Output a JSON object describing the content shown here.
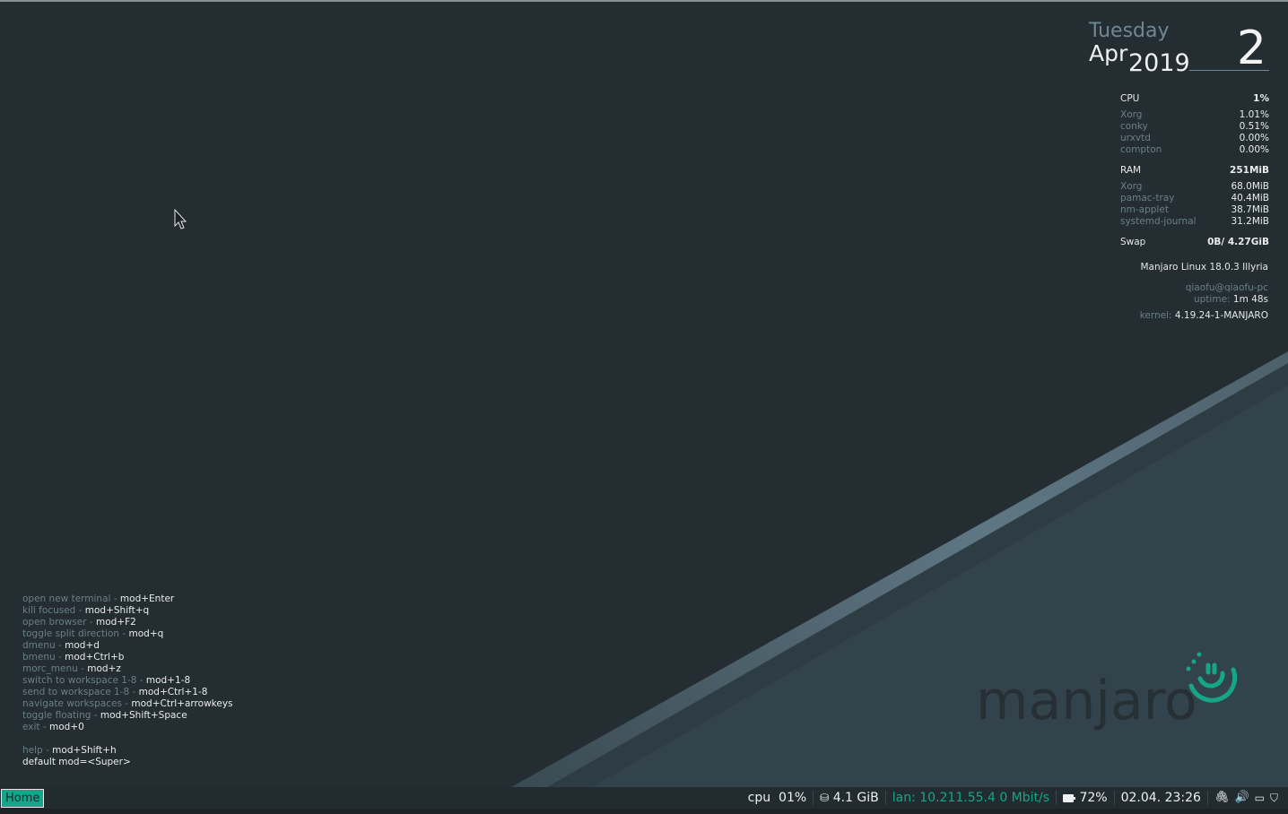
{
  "conky": {
    "date": {
      "weekday": "Tuesday",
      "month": "Apr",
      "year": "2019",
      "day": "2"
    },
    "cpu": {
      "label": "CPU",
      "total": "1%",
      "processes": [
        {
          "name": "Xorg",
          "value": "1.01%"
        },
        {
          "name": "conky",
          "value": "0.51%"
        },
        {
          "name": "urxvtd",
          "value": "0.00%"
        },
        {
          "name": "compton",
          "value": "0.00%"
        }
      ]
    },
    "ram": {
      "label": "RAM",
      "total": "251MiB",
      "processes": [
        {
          "name": "Xorg",
          "value": "68.0MiB"
        },
        {
          "name": "pamac-tray",
          "value": "40.4MiB"
        },
        {
          "name": "nm-applet",
          "value": "38.7MiB"
        },
        {
          "name": "systemd-journal",
          "value": "31.2MiB"
        }
      ]
    },
    "swap": {
      "label": "Swap",
      "value": "0B/ 4.27GiB"
    },
    "os": "Manjaro Linux 18.0.3 Illyria",
    "user": "qiaofu@qiaofu-pc",
    "uptime_label": "uptime:",
    "uptime": "1m 48s",
    "kernel_label": "kernel:",
    "kernel": "4.19.24-1-MANJARO"
  },
  "help": {
    "items": [
      {
        "desc": "open new terminal - ",
        "keys": "mod+Enter"
      },
      {
        "desc": "kill focused - ",
        "keys": "mod+Shift+q"
      },
      {
        "desc": "open browser - ",
        "keys": "mod+F2"
      },
      {
        "desc": "toggle split direction - ",
        "keys": "mod+q"
      },
      {
        "desc": "dmenu - ",
        "keys": "mod+d"
      },
      {
        "desc": "bmenu - ",
        "keys": "mod+Ctrl+b"
      },
      {
        "desc": "morc_menu - ",
        "keys": "mod+z"
      },
      {
        "desc": "switch to workspace 1-8 - ",
        "keys": "mod+1-8"
      },
      {
        "desc": "send to workspace 1-8 - ",
        "keys": "mod+Ctrl+1-8"
      },
      {
        "desc": "navigate workspaces - ",
        "keys": "mod+Ctrl+arrowkeys"
      },
      {
        "desc": "toggle floating - ",
        "keys": "mod+Shift+Space"
      },
      {
        "desc": "exit - ",
        "keys": "mod+0"
      }
    ],
    "help_desc": "help - ",
    "help_keys": "mod+Shift+h",
    "default_mod": "default mod=<Super>"
  },
  "logo": {
    "text": "manjaro"
  },
  "bar": {
    "workspace": "Home",
    "cpu_label": "cpu",
    "cpu_value": "01%",
    "disk": "4.1 GiB",
    "lan": "lan: 10.211.55.4 0 Mbit/s",
    "battery": "72%",
    "datetime": "02.04. 23:26"
  },
  "colors": {
    "background": "#232d32",
    "accent": "#17a589",
    "dim_text": "#6b7f88",
    "stripe": "#5d7380"
  }
}
